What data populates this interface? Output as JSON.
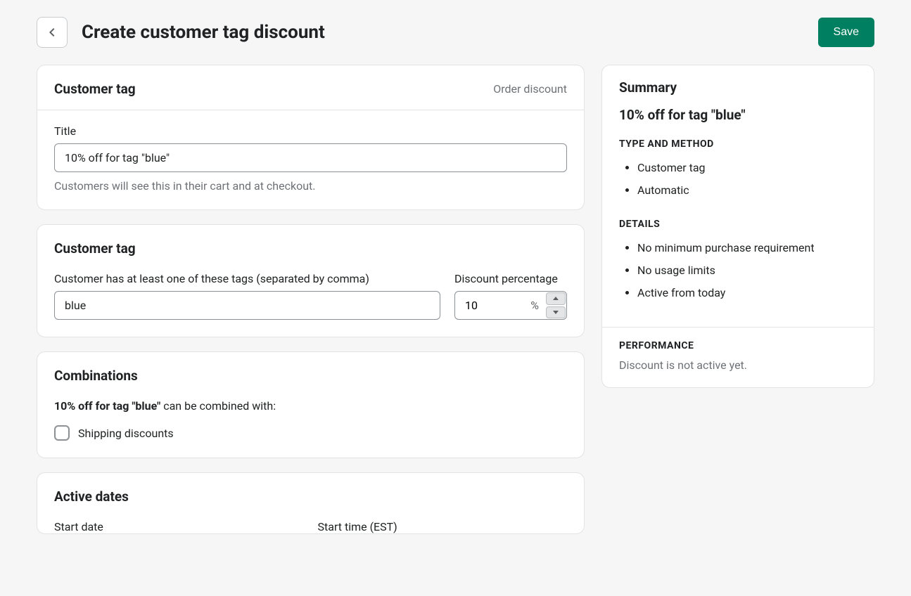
{
  "header": {
    "page_title": "Create customer tag discount",
    "save_label": "Save"
  },
  "card_customer_tag_title": {
    "title": "Customer tag",
    "badge": "Order discount",
    "field_label": "Title",
    "title_value": "10% off for tag \"blue\"",
    "help_text": "Customers will see this in their cart and at checkout."
  },
  "card_tag_percent": {
    "title": "Customer tag",
    "tag_label": "Customer has at least one of these tags (separated by comma)",
    "tag_value": "blue",
    "percent_label": "Discount percentage",
    "percent_value": "10",
    "percent_sign": "%"
  },
  "card_combinations": {
    "title": "Combinations",
    "discount_name": "10% off for tag \"blue\"",
    "combine_suffix": " can be combined with:",
    "option_shipping": "Shipping discounts"
  },
  "card_active_dates": {
    "title": "Active dates",
    "start_date_label": "Start date",
    "start_time_label": "Start time (EST)"
  },
  "summary": {
    "heading": "Summary",
    "discount_title": "10% off for tag \"blue\"",
    "type_method_label": "TYPE AND METHOD",
    "type_method_items": [
      "Customer tag",
      "Automatic"
    ],
    "details_label": "DETAILS",
    "details_items": [
      "No minimum purchase requirement",
      "No usage limits",
      "Active from today"
    ],
    "performance_label": "PERFORMANCE",
    "performance_text": "Discount is not active yet."
  }
}
